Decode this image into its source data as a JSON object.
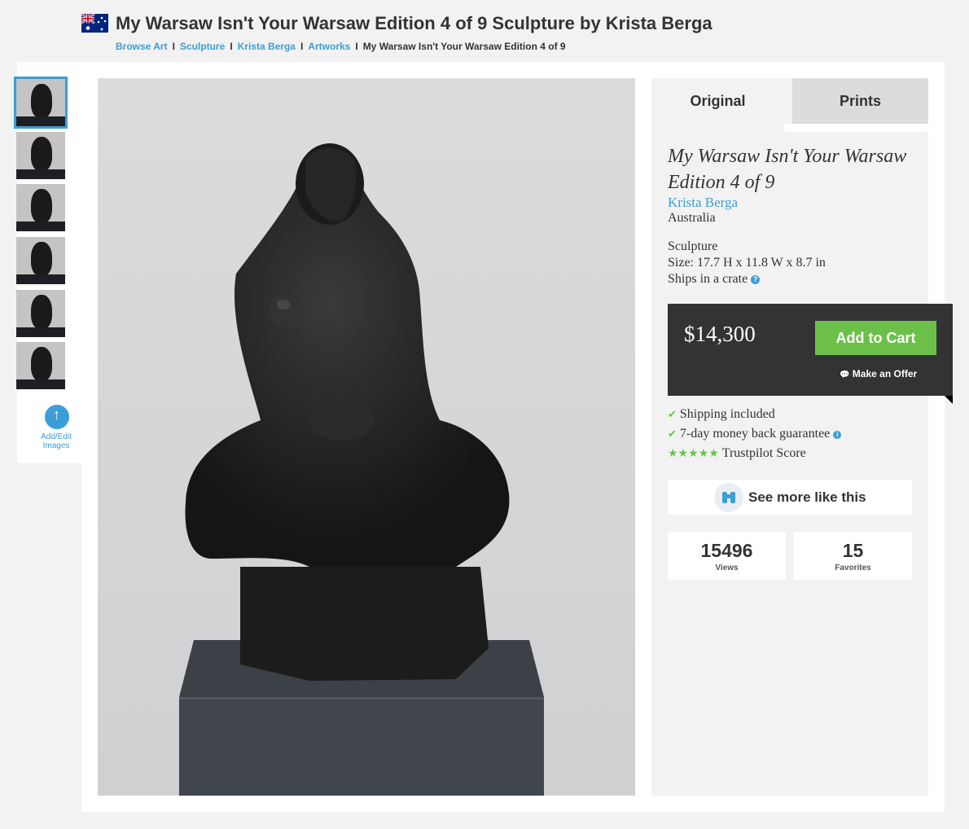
{
  "header": {
    "title": "My Warsaw Isn't Your Warsaw Edition 4 of 9 Sculpture by Krista Berga",
    "flag_icon": "australia-flag-icon"
  },
  "breadcrumb": {
    "items": [
      "Browse Art",
      "Sculpture",
      "Krista Berga",
      "Artworks"
    ],
    "current": "My Warsaw Isn't Your Warsaw Edition 4 of 9"
  },
  "thumbnails": {
    "count": 6,
    "selected_index": 0,
    "add_label": "Add/Edit Images",
    "add_icon": "upload-icon"
  },
  "tabs": {
    "original": "Original",
    "prints": "Prints",
    "active": "Original"
  },
  "artwork": {
    "title": "My Warsaw Isn't Your Warsaw Edition 4 of 9",
    "artist": "Krista Berga",
    "country": "Australia",
    "medium": "Sculpture",
    "size": "Size: 17.7 H x 11.8 W x 8.7 in",
    "ships": "Ships in a crate"
  },
  "purchase": {
    "price": "$14,300",
    "add_to_cart": "Add to Cart",
    "make_offer": "Make an Offer",
    "offer_icon": "chat-bubbles-icon"
  },
  "perks": {
    "shipping": "Shipping included",
    "guarantee": "7-day money back guarantee",
    "trustpilot": "Trustpilot Score",
    "trustpilot_stars": 5
  },
  "see_more": {
    "label": "See more like this",
    "icon": "binoculars-icon"
  },
  "stats": {
    "views": "15496",
    "views_label": "Views",
    "favorites": "15",
    "favorites_label": "Favorites"
  },
  "colors": {
    "link": "#3a9fd6",
    "cart_green": "#6cc04a",
    "buybox": "#333333",
    "background": "#f2f2f2"
  }
}
